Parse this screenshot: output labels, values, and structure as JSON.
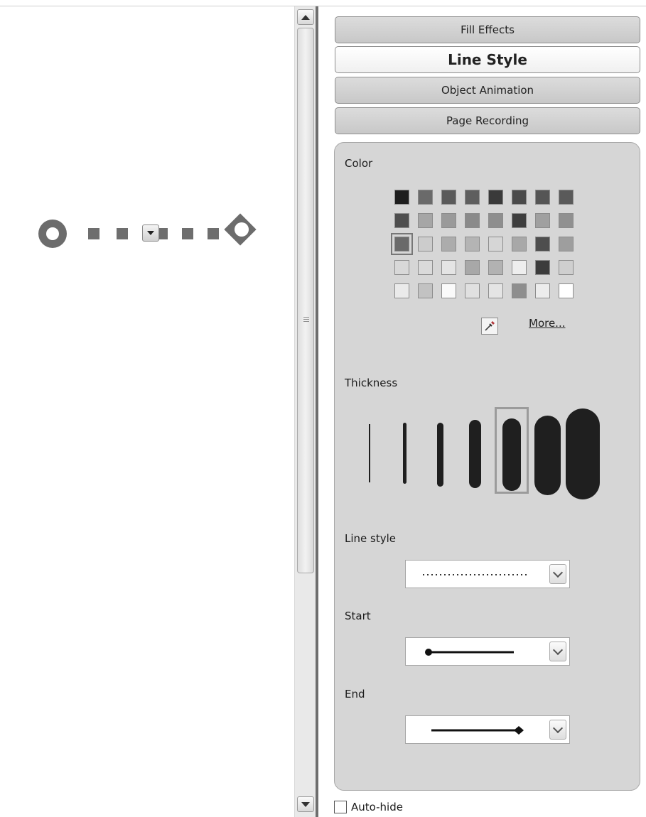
{
  "tabs": {
    "fill_effects": "Fill Effects",
    "line_style": "Line Style",
    "object_animation": "Object Animation",
    "page_recording": "Page Recording"
  },
  "properties": {
    "color_label": "Color",
    "more_link": "More...",
    "thickness_label": "Thickness",
    "line_style_label": "Line style",
    "start_label": "Start",
    "end_label": "End",
    "line_style_value": "dotted",
    "start_value": "round-dot-start",
    "end_value": "diamond-end",
    "selected_thickness_index": 4,
    "selected_color": "#6a6a6a",
    "swatch_colors": [
      [
        "#1e1e1e",
        "#6a6a6a",
        "#5a5a5a",
        "#5e5e5e",
        "#3a3a3a",
        "#4a4a4a",
        "#555555",
        "#5a5a5a"
      ],
      [
        "#4e4e4e",
        "#a6a6a6",
        "#9a9a9a",
        "#8a8a8a",
        "#8e8e8e",
        "#3e3e3e",
        "#a0a0a0",
        "#909090"
      ],
      [
        "#6a6a6a",
        "#cccccc",
        "#acacac",
        "#b4b4b4",
        "#d6d6d6",
        "#a8a8a8",
        "#4e4e4e",
        "#9e9e9e"
      ],
      [
        "#d8d8d8",
        "#dadada",
        "#e4e4e4",
        "#a8a8a8",
        "#b2b2b2",
        "#eeeeee",
        "#3c3c3c",
        "#cfcfcf"
      ],
      [
        "#eaeaea",
        "#c2c2c2",
        "#fafafa",
        "#e0e0e0",
        "#e4e4e4",
        "#8e8e8e",
        "#ececec",
        "#ffffff"
      ]
    ]
  },
  "autohide_label": "Auto-hide",
  "icons": {
    "scroll_up": "arrow-up-icon",
    "scroll_down": "arrow-down-icon",
    "eyedropper": "eyedropper-icon",
    "object_menu": "chevron-down-icon"
  }
}
